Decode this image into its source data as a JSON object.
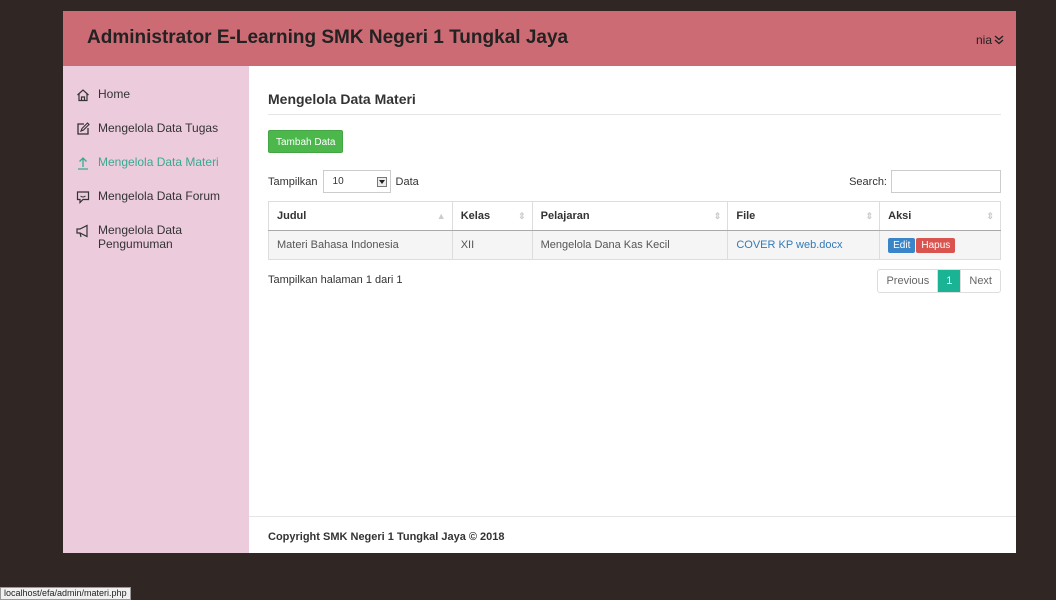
{
  "header": {
    "title": "Administrator E-Learning SMK Negeri 1 Tungkal Jaya",
    "user": "nia",
    "user_icon": "chevron-double-down-icon"
  },
  "sidebar": {
    "items": [
      {
        "label": "Home",
        "icon": "home-icon",
        "active": false
      },
      {
        "label": "Mengelola Data Tugas",
        "icon": "edit-icon",
        "active": false
      },
      {
        "label": "Mengelola Data Materi",
        "icon": "upload-icon",
        "active": true
      },
      {
        "label": "Mengelola Data Forum",
        "icon": "comment-icon",
        "active": false
      },
      {
        "label": "Mengelola Data Pengumuman",
        "icon": "bullhorn-icon",
        "active": false
      }
    ]
  },
  "main": {
    "title": "Mengelola Data Materi",
    "add_button": "Tambah Data",
    "length_label_prefix": "Tampilkan",
    "length_value": "10",
    "length_label_suffix": "Data",
    "search_label": "Search:",
    "search_value": "",
    "table": {
      "headers": [
        "Judul",
        "Kelas",
        "Pelajaran",
        "File",
        "Aksi"
      ],
      "rows": [
        {
          "judul": "Materi Bahasa Indonesia",
          "kelas": "XII",
          "pelajaran": "Mengelola Dana Kas Kecil",
          "file": "COVER KP web.docx",
          "edit": "Edit",
          "hapus": "Hapus"
        }
      ]
    },
    "info": "Tampilkan halaman 1 dari 1",
    "pager": {
      "previous": "Previous",
      "current": "1",
      "next": "Next"
    }
  },
  "footer": {
    "text": "Copyright SMK Negeri 1 Tungkal Jaya © 2018"
  },
  "statusbar": {
    "url": "localhost/efa/admin/materi.php"
  },
  "colors": {
    "header": "#cd6b74",
    "sidebar": "#eccbdd",
    "active": "#3aa98f",
    "add": "#4cb84c",
    "edit": "#3a85c8",
    "delete": "#d9534f",
    "page_current": "#1ab394"
  }
}
